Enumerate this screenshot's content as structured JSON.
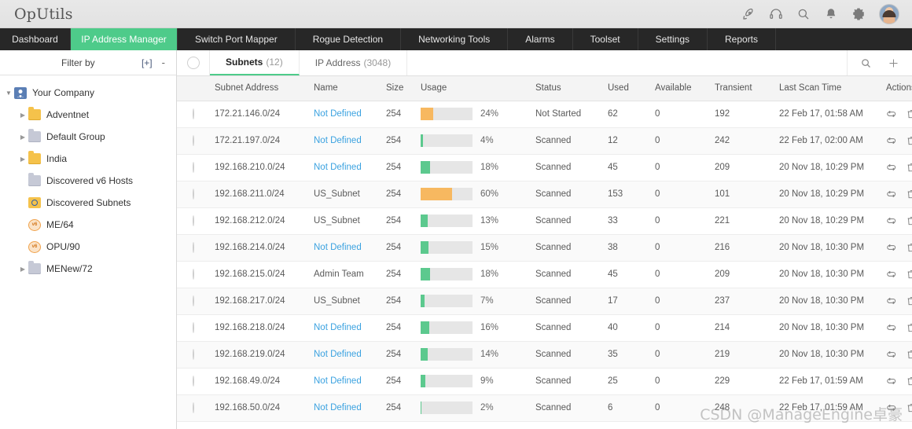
{
  "app": {
    "brand": "OpUtils",
    "watermark": "CSDN @ManageEngine卓豪"
  },
  "topbar": {
    "icons": [
      {
        "name": "rocket-icon",
        "label": "rocket"
      },
      {
        "name": "headset-icon",
        "label": "headset"
      },
      {
        "name": "search-icon",
        "label": "search"
      },
      {
        "name": "bell-icon",
        "label": "notifications"
      },
      {
        "name": "gear-icon",
        "label": "settings"
      }
    ],
    "avatar_label": "user-avatar"
  },
  "nav": {
    "items": [
      {
        "label": "Dashboard",
        "active": false
      },
      {
        "label": "IP Address Manager",
        "active": true
      },
      {
        "label": "Switch Port Mapper",
        "active": false
      },
      {
        "label": "Rogue Detection",
        "active": false
      },
      {
        "label": "Networking Tools",
        "active": false
      },
      {
        "label": "Alarms",
        "active": false
      },
      {
        "label": "Toolset",
        "active": false
      },
      {
        "label": "Settings",
        "active": false
      },
      {
        "label": "Reports",
        "active": false
      }
    ],
    "accent": "#4ecb8a"
  },
  "sidebar": {
    "filter_label": "Filter by",
    "expand_all": "[+]",
    "collapse_all": "-",
    "tree": [
      {
        "label": "Your Company",
        "icon": "user-icon",
        "indent": 0,
        "arrow": "open"
      },
      {
        "label": "Adventnet",
        "icon": "folder-yellow-icon",
        "indent": 1,
        "arrow": "closed"
      },
      {
        "label": "Default Group",
        "icon": "folder-gray-icon",
        "indent": 1,
        "arrow": "closed"
      },
      {
        "label": "India",
        "icon": "folder-yellow-icon",
        "indent": 1,
        "arrow": "closed"
      },
      {
        "label": "Discovered v6 Hosts",
        "icon": "folder-gray-icon",
        "indent": 1,
        "arrow": "none"
      },
      {
        "label": "Discovered Subnets",
        "icon": "search-folder-icon",
        "indent": 1,
        "arrow": "none"
      },
      {
        "label": "ME/64",
        "icon": "v6-icon",
        "indent": 1,
        "arrow": "none"
      },
      {
        "label": "OPU/90",
        "icon": "v6-icon",
        "indent": 1,
        "arrow": "none"
      },
      {
        "label": "MENew/72",
        "icon": "folder-gray-icon",
        "indent": 1,
        "arrow": "closed"
      }
    ]
  },
  "main": {
    "tabs": [
      {
        "label": "Subnets",
        "count": "(12)",
        "active": true
      },
      {
        "label": "IP Address",
        "count": "(3048)",
        "active": false
      }
    ],
    "toolbar": {
      "search_icon": "search-icon",
      "add_icon": "plus-icon"
    },
    "columns": [
      "Subnet Address",
      "Name",
      "Size",
      "Usage",
      "Status",
      "Used",
      "Available",
      "Transient",
      "Last Scan Time",
      "Actions"
    ],
    "rows": [
      {
        "address": "172.21.146.0/24",
        "name": "Not Defined",
        "name_link": true,
        "size": "254",
        "usage": 24,
        "usage_label": "24%",
        "usage_color": "#f7b860",
        "status": "Not Started",
        "used": "62",
        "available": "0",
        "transient": "192",
        "scan": "22 Feb 17, 01:58 AM"
      },
      {
        "address": "172.21.197.0/24",
        "name": "Not Defined",
        "name_link": true,
        "size": "254",
        "usage": 4,
        "usage_label": "4%",
        "usage_color": "#5cc98e",
        "status": "Scanned",
        "used": "12",
        "available": "0",
        "transient": "242",
        "scan": "22 Feb 17, 02:00 AM"
      },
      {
        "address": "192.168.210.0/24",
        "name": "Not Defined",
        "name_link": true,
        "size": "254",
        "usage": 18,
        "usage_label": "18%",
        "usage_color": "#5cc98e",
        "status": "Scanned",
        "used": "45",
        "available": "0",
        "transient": "209",
        "scan": "20 Nov 18, 10:29 PM"
      },
      {
        "address": "192.168.211.0/24",
        "name": "US_Subnet",
        "name_link": false,
        "size": "254",
        "usage": 60,
        "usage_label": "60%",
        "usage_color": "#f7b860",
        "status": "Scanned",
        "used": "153",
        "available": "0",
        "transient": "101",
        "scan": "20 Nov 18, 10:29 PM"
      },
      {
        "address": "192.168.212.0/24",
        "name": "US_Subnet",
        "name_link": false,
        "size": "254",
        "usage": 13,
        "usage_label": "13%",
        "usage_color": "#5cc98e",
        "status": "Scanned",
        "used": "33",
        "available": "0",
        "transient": "221",
        "scan": "20 Nov 18, 10:29 PM"
      },
      {
        "address": "192.168.214.0/24",
        "name": "Not Defined",
        "name_link": true,
        "size": "254",
        "usage": 15,
        "usage_label": "15%",
        "usage_color": "#5cc98e",
        "status": "Scanned",
        "used": "38",
        "available": "0",
        "transient": "216",
        "scan": "20 Nov 18, 10:30 PM"
      },
      {
        "address": "192.168.215.0/24",
        "name": "Admin Team",
        "name_link": false,
        "size": "254",
        "usage": 18,
        "usage_label": "18%",
        "usage_color": "#5cc98e",
        "status": "Scanned",
        "used": "45",
        "available": "0",
        "transient": "209",
        "scan": "20 Nov 18, 10:30 PM"
      },
      {
        "address": "192.168.217.0/24",
        "name": "US_Subnet",
        "name_link": false,
        "size": "254",
        "usage": 7,
        "usage_label": "7%",
        "usage_color": "#5cc98e",
        "status": "Scanned",
        "used": "17",
        "available": "0",
        "transient": "237",
        "scan": "20 Nov 18, 10:30 PM"
      },
      {
        "address": "192.168.218.0/24",
        "name": "Not Defined",
        "name_link": true,
        "size": "254",
        "usage": 16,
        "usage_label": "16%",
        "usage_color": "#5cc98e",
        "status": "Scanned",
        "used": "40",
        "available": "0",
        "transient": "214",
        "scan": "20 Nov 18, 10:30 PM"
      },
      {
        "address": "192.168.219.0/24",
        "name": "Not Defined",
        "name_link": true,
        "size": "254",
        "usage": 14,
        "usage_label": "14%",
        "usage_color": "#5cc98e",
        "status": "Scanned",
        "used": "35",
        "available": "0",
        "transient": "219",
        "scan": "20 Nov 18, 10:30 PM"
      },
      {
        "address": "192.168.49.0/24",
        "name": "Not Defined",
        "name_link": true,
        "size": "254",
        "usage": 9,
        "usage_label": "9%",
        "usage_color": "#5cc98e",
        "status": "Scanned",
        "used": "25",
        "available": "0",
        "transient": "229",
        "scan": "22 Feb 17, 01:59 AM"
      },
      {
        "address": "192.168.50.0/24",
        "name": "Not Defined",
        "name_link": true,
        "size": "254",
        "usage": 2,
        "usage_label": "2%",
        "usage_color": "#5cc98e",
        "status": "Scanned",
        "used": "6",
        "available": "0",
        "transient": "248",
        "scan": "22 Feb 17, 01:59 AM"
      }
    ],
    "row_actions": [
      {
        "name": "scan-icon",
        "label": "scan"
      },
      {
        "name": "delete-icon",
        "label": "delete"
      }
    ]
  }
}
